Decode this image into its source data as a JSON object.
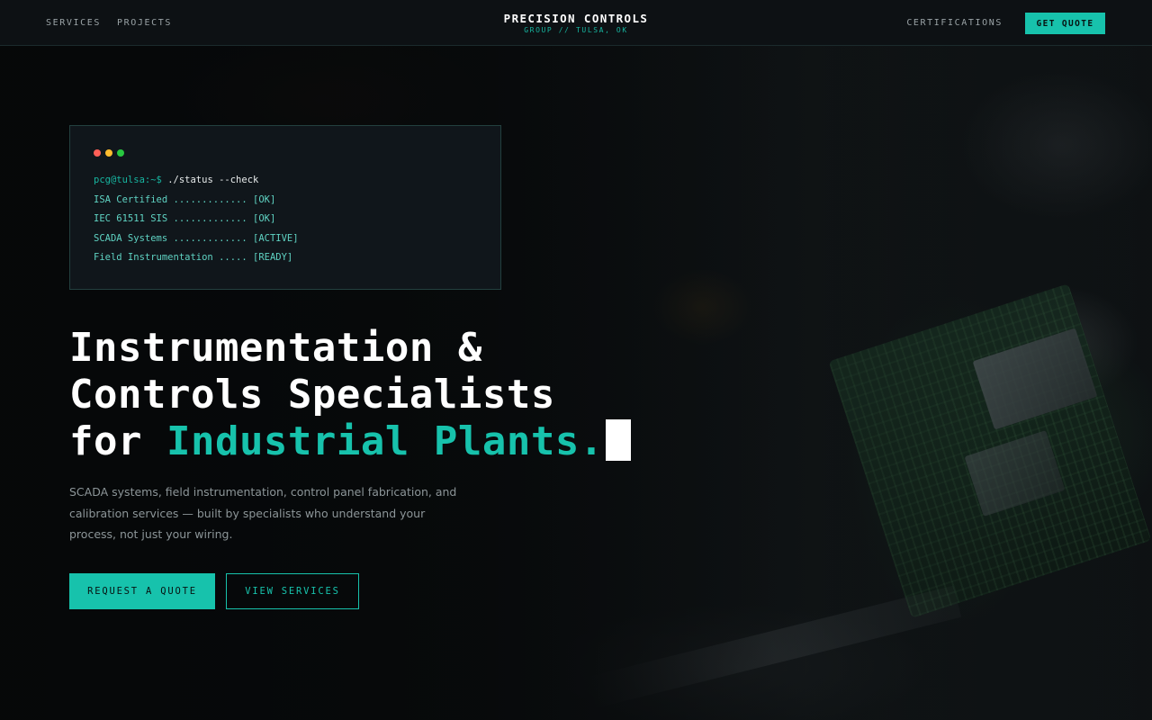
{
  "header": {
    "nav_left": [
      "SERVICES",
      "PROJECTS"
    ],
    "brand_title": "PRECISION CONTROLS",
    "brand_subtitle": "GROUP // TULSA, OK",
    "nav_right": "CERTIFICATIONS",
    "cta_label": "GET QUOTE"
  },
  "terminal": {
    "prompt": "pcg@tulsa:~$",
    "command": "./status --check",
    "lines": [
      "ISA Certified ............. [OK]",
      "IEC 61511 SIS ............. [OK]",
      "SCADA Systems ............. [ACTIVE]",
      "Field Instrumentation ..... [READY]"
    ]
  },
  "hero": {
    "headline_line1": "Instrumentation &",
    "headline_line2": "Controls Specialists",
    "headline_line3_prefix": "for ",
    "headline_line3_accent": "Industrial Plants.",
    "subtext": "SCADA systems, field instrumentation, control panel fabrication, and calibration services — built by specialists who understand your process, not just your wiring.",
    "primary_button": "REQUEST A QUOTE",
    "secondary_button": "VIEW SERVICES"
  },
  "colors": {
    "accent": "#17c2ac",
    "background": "#0a0c0e",
    "header_bg": "#0d1114",
    "terminal_bg": "#11171c"
  }
}
